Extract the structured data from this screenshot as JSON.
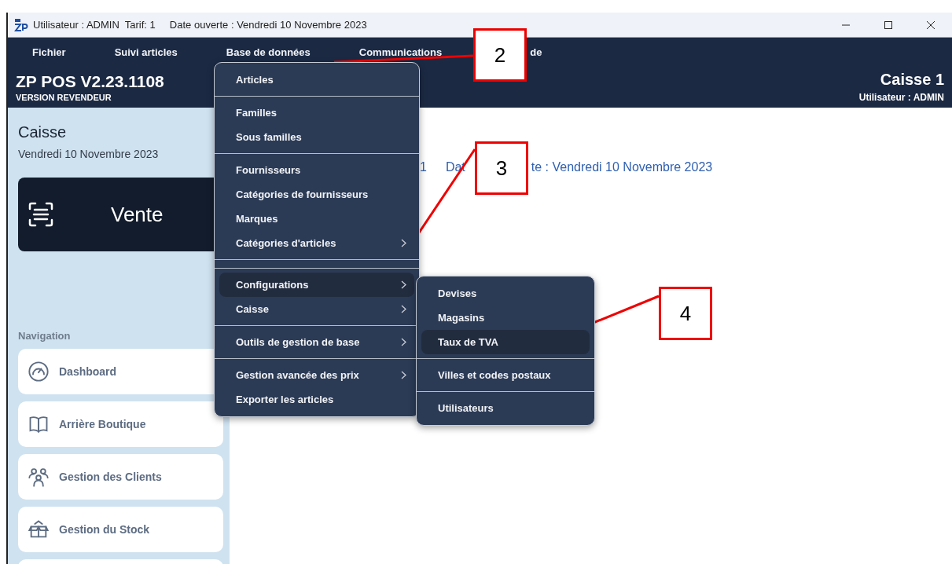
{
  "window": {
    "title": "Utilisateur : ADMIN  Tarif: 1     Date ouverte : Vendredi 10 Novembre 2023"
  },
  "menubar": [
    {
      "label": "Fichier"
    },
    {
      "label": "Suivi articles"
    },
    {
      "label": "Base de données"
    },
    {
      "label": "Communications"
    },
    {
      "label": "de"
    }
  ],
  "header": {
    "app_name": "ZP POS V2.23.1108",
    "edition": "VERSION REVENDEUR",
    "register": "Caisse 1",
    "user": "Utilisateur : ADMIN"
  },
  "sidebar": {
    "title": "Caisse",
    "date": "Vendredi 10 Novembre 2023",
    "sale_button": "Vente",
    "nav_heading": "Navigation",
    "nav_items": [
      {
        "label": "Dashboard"
      },
      {
        "label": "Arrière Boutique"
      },
      {
        "label": "Gestion des Clients"
      },
      {
        "label": "Gestion du Stock"
      }
    ]
  },
  "main": {
    "info_parts": [
      "1",
      "Dat",
      "te : Vendredi 10 Novembre 2023"
    ]
  },
  "dropdown": {
    "items": [
      {
        "kind": "item",
        "label": "Articles",
        "submenu": false,
        "selected": false
      },
      {
        "kind": "separator"
      },
      {
        "kind": "item",
        "label": "Familles",
        "submenu": false,
        "selected": false
      },
      {
        "kind": "item",
        "label": "Sous familles",
        "submenu": false,
        "selected": false
      },
      {
        "kind": "separator"
      },
      {
        "kind": "item",
        "label": "Fournisseurs",
        "submenu": false,
        "selected": false
      },
      {
        "kind": "item",
        "label": "Catégories de fournisseurs",
        "submenu": false,
        "selected": false
      },
      {
        "kind": "item",
        "label": "Marques",
        "submenu": false,
        "selected": false
      },
      {
        "kind": "item",
        "label": "Catégories d'articles",
        "submenu": true,
        "selected": false
      },
      {
        "kind": "separator"
      },
      {
        "kind": "separator"
      },
      {
        "kind": "item",
        "label": "Configurations",
        "submenu": true,
        "selected": true
      },
      {
        "kind": "item",
        "label": "Caisse",
        "submenu": true,
        "selected": false
      },
      {
        "kind": "separator"
      },
      {
        "kind": "item",
        "label": "Outils de gestion de base",
        "submenu": true,
        "selected": false
      },
      {
        "kind": "separator"
      },
      {
        "kind": "item",
        "label": "Gestion avancée des prix",
        "submenu": true,
        "selected": false
      },
      {
        "kind": "item",
        "label": "Exporter les articles",
        "submenu": false,
        "selected": false
      }
    ]
  },
  "submenu": {
    "items": [
      {
        "kind": "item",
        "label": "Devises",
        "submenu": false,
        "selected": false
      },
      {
        "kind": "item",
        "label": "Magasins",
        "submenu": false,
        "selected": false
      },
      {
        "kind": "item",
        "label": "Taux de TVA",
        "submenu": false,
        "selected": true
      },
      {
        "kind": "separator"
      },
      {
        "kind": "item",
        "label": "Villes et codes postaux",
        "submenu": false,
        "selected": false
      },
      {
        "kind": "separator"
      },
      {
        "kind": "item",
        "label": "Utilisateurs",
        "submenu": false,
        "selected": false
      }
    ]
  },
  "annotations": [
    {
      "label": "2"
    },
    {
      "label": "3"
    },
    {
      "label": "4"
    }
  ]
}
